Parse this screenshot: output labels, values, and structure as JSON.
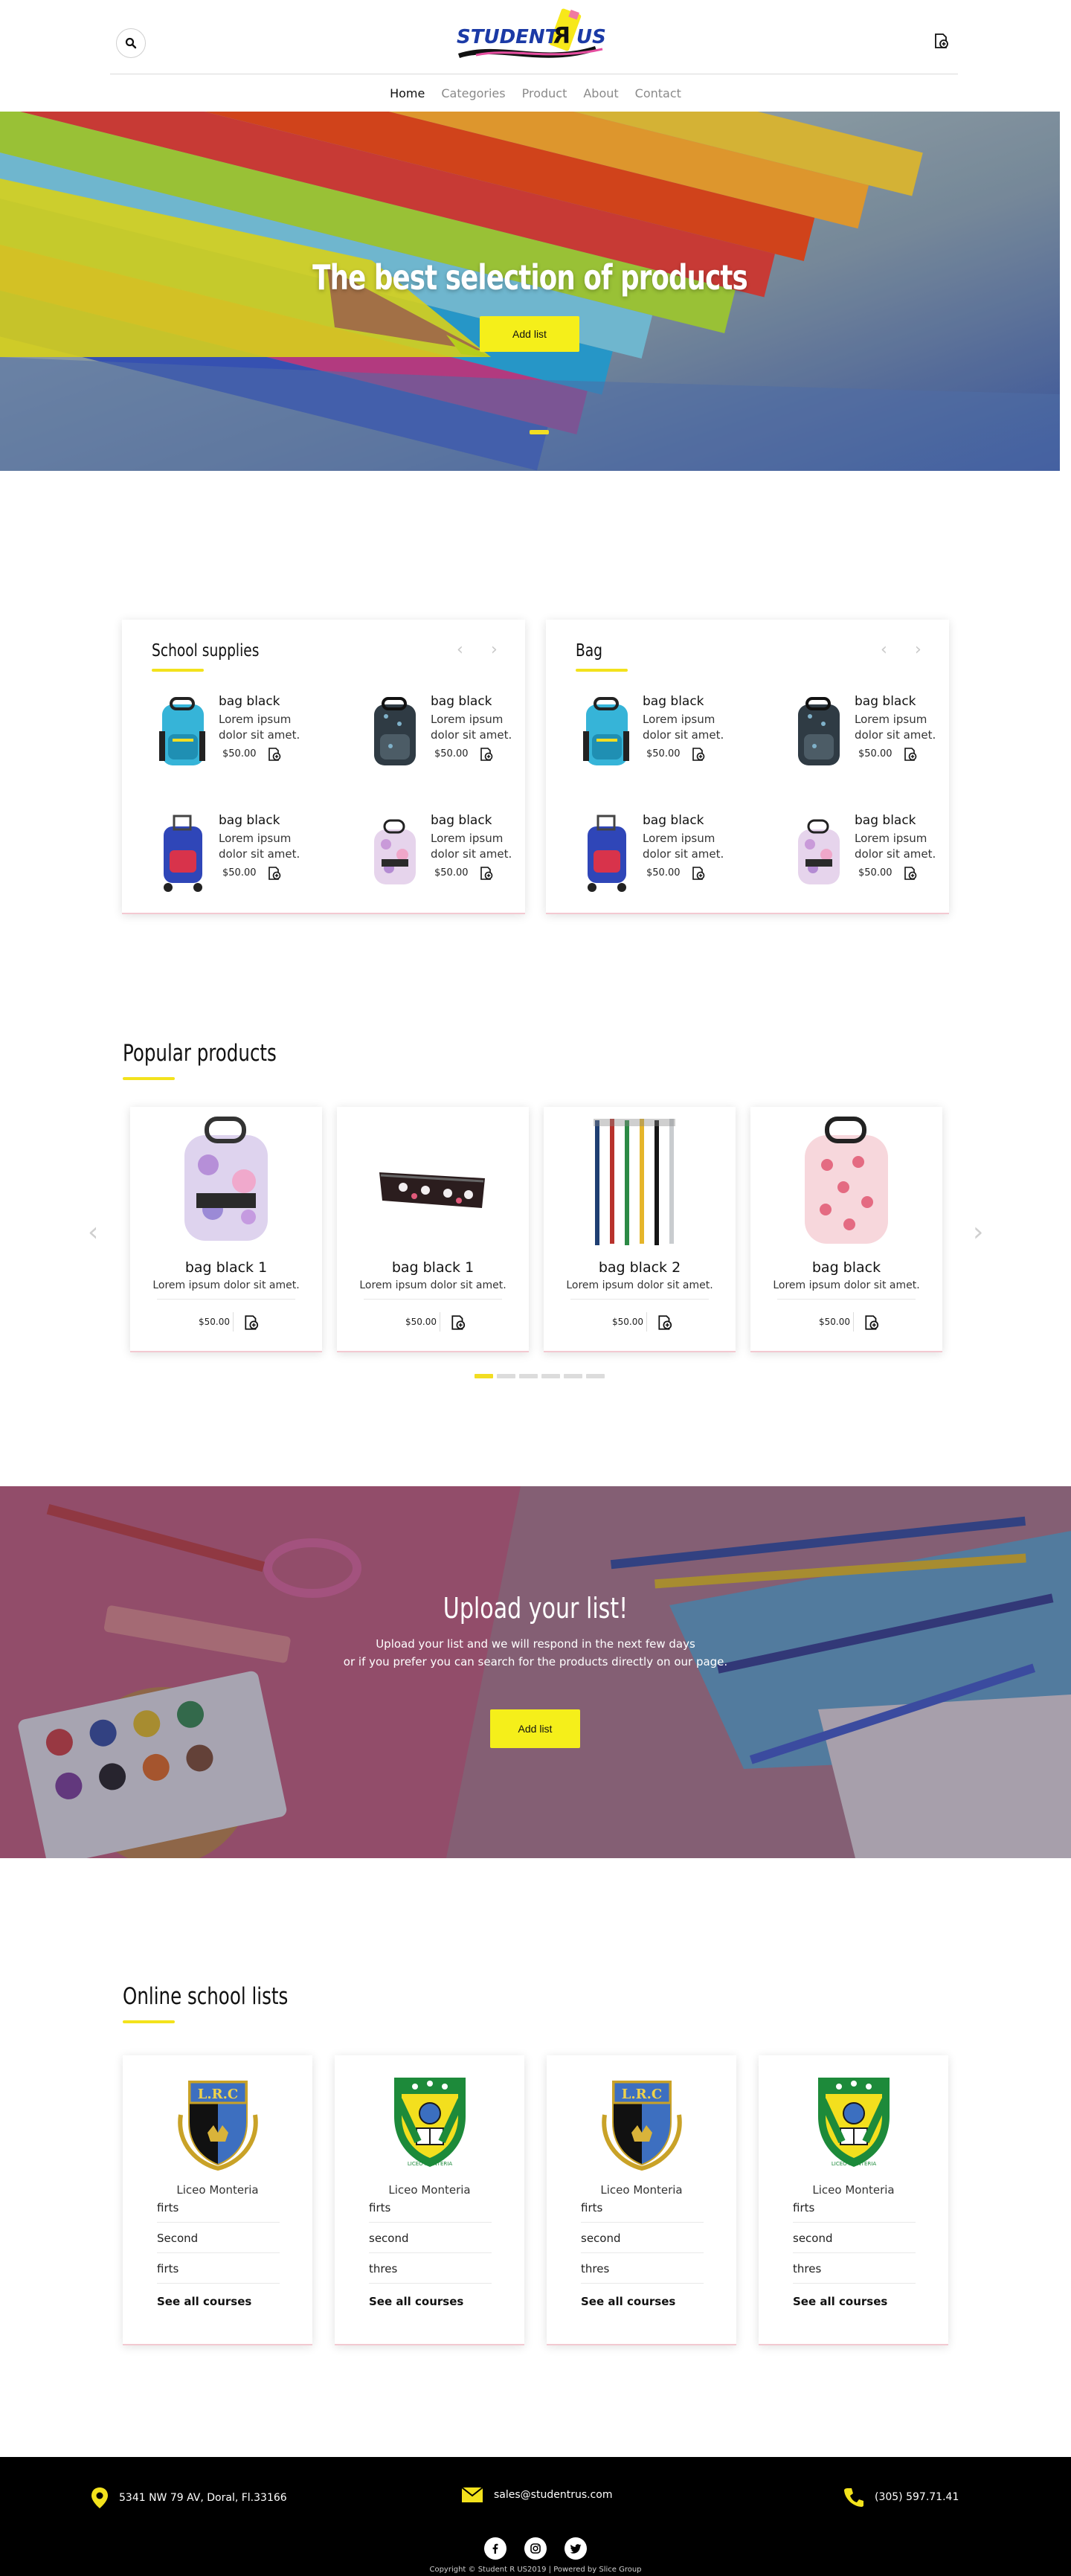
{
  "brand": {
    "logo_text_left": "STUDENT",
    "logo_text_mid": "R",
    "logo_text_right": "US",
    "accent": "#f5ef1a",
    "blue": "#1b3aa6"
  },
  "header": {
    "search_icon": "search-icon",
    "cart_icon": "cart-icon"
  },
  "nav": {
    "items": [
      "Home",
      "Categories",
      "Product",
      "About",
      "Contact"
    ],
    "active": "Home"
  },
  "hero": {
    "title": "The best selection of products",
    "button": "Add list"
  },
  "categories": [
    {
      "title": "School supplies",
      "products": [
        {
          "name": "bag black",
          "desc": "Lorem ipsum dolor sit amet.",
          "price": "$50.00",
          "image": "blue-backpack"
        },
        {
          "name": "bag black",
          "desc": "Lorem ipsum dolor sit amet.",
          "price": "$50.00",
          "image": "dark-backpack"
        },
        {
          "name": "bag black",
          "desc": "Lorem ipsum dolor sit amet.",
          "price": "$50.00",
          "image": "rolling-backpack"
        },
        {
          "name": "bag black",
          "desc": "Lorem ipsum dolor sit amet.",
          "price": "$50.00",
          "image": "floral-backpack"
        }
      ]
    },
    {
      "title": "Bag",
      "products": [
        {
          "name": "bag black",
          "desc": "Lorem ipsum dolor sit amet.",
          "price": "$50.00",
          "image": "blue-backpack"
        },
        {
          "name": "bag black",
          "desc": "Lorem ipsum dolor sit amet.",
          "price": "$50.00",
          "image": "dark-backpack"
        },
        {
          "name": "bag black",
          "desc": "Lorem ipsum dolor sit amet.",
          "price": "$50.00",
          "image": "rolling-backpack"
        },
        {
          "name": "bag black",
          "desc": "Lorem ipsum dolor sit amet.",
          "price": "$50.00",
          "image": "floral-backpack"
        }
      ]
    }
  ],
  "popular": {
    "title": "Popular products",
    "products": [
      {
        "name": "bag black 1",
        "desc": "Lorem ipsum dolor sit amet.",
        "price": "$50.00",
        "image": "floral-backpack"
      },
      {
        "name": "bag black 1",
        "desc": "Lorem ipsum dolor sit amet.",
        "price": "$50.00",
        "image": "pencil-case"
      },
      {
        "name": "bag black 2",
        "desc": "Lorem ipsum dolor sit amet.",
        "price": "$50.00",
        "image": "pencils"
      },
      {
        "name": "bag black",
        "desc": "Lorem ipsum dolor sit amet.",
        "price": "$50.00",
        "image": "pink-backpack"
      }
    ],
    "page_count": 6,
    "active_page": 1
  },
  "upload": {
    "title": "Upload your list!",
    "line1": "Upload your list and we will respond in the next few days",
    "line2": "or if you prefer you can search for the products directly on our page.",
    "button": "Add list"
  },
  "schools": {
    "title": "Online school lists",
    "items": [
      {
        "crest": "lrc-crest",
        "crest_text": "L.R.C",
        "name": "Liceo Monteria",
        "courses": [
          "firts",
          "Second",
          "firts"
        ],
        "link": "See all courses"
      },
      {
        "crest": "liceo-crest",
        "crest_text": "LICEO MONTERIA",
        "name": "Liceo Monteria",
        "courses": [
          "firts",
          "second",
          "thres"
        ],
        "link": "See all courses"
      },
      {
        "crest": "lrc-crest",
        "crest_text": "L.R.C",
        "name": "Liceo Monteria",
        "courses": [
          "firts",
          "second",
          "thres"
        ],
        "link": "See all courses"
      },
      {
        "crest": "liceo-crest",
        "crest_text": "LICEO MONTERIA",
        "name": "Liceo Monteria",
        "courses": [
          "firts",
          "second",
          "thres"
        ],
        "link": "See all courses"
      }
    ]
  },
  "footer": {
    "address": "5341 NW 79 AV, Doral, Fl.33166",
    "email": "sales@studentrus.com",
    "phone": "(305) 597.71.41",
    "social": [
      "facebook-icon",
      "instagram-icon",
      "twitter-icon"
    ],
    "copyright": "Copyright © Student R US2019 | Powered by Slice Group"
  }
}
